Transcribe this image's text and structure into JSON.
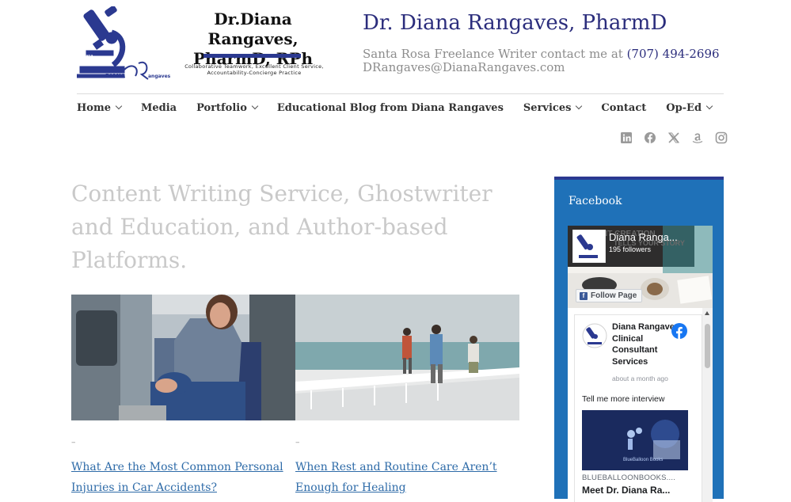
{
  "logo": {
    "title": "Dr.Diana Rangaves, PharmD, RPh",
    "tagline": "Collaborative Teamwork, Excellent Client Service, Accountability-Concierge Practice",
    "mark_text_left": "DIANA",
    "mark_text_right": "angaves",
    "mark_small": "Diana"
  },
  "header": {
    "site_title": "Dr. Diana Rangaves, PharmD",
    "tagline_text": "Santa Rosa Freelance Writer contact me at ",
    "phone": "(707) 494-2696",
    "email": "DRangaves@DianaRangaves.com"
  },
  "nav": {
    "items": [
      {
        "label": "Home"
      },
      {
        "label": "Media"
      },
      {
        "label": "Portfolio"
      },
      {
        "label": "Educational Blog from Diana Rangaves"
      },
      {
        "label": "Services"
      },
      {
        "label": "Contact"
      },
      {
        "label": "Op-Ed"
      }
    ]
  },
  "social": {
    "icons": [
      "linkedin-icon",
      "facebook-icon",
      "x-icon",
      "amazon-icon",
      "instagram-icon"
    ]
  },
  "main": {
    "title": "Content Writing Service, Ghostwriter and Education, and Author-based Platforms.",
    "posts": [
      {
        "dash": "–",
        "title": "What Are the Most Common Personal Injuries in Car Accidents?"
      },
      {
        "dash": "–",
        "title": "When Rest and Routine Care Aren’t Enough for Healing"
      }
    ]
  },
  "sidebar": {
    "heading": "Facebook",
    "fb": {
      "cover_text": "CONTENT CREATION",
      "cover_text2": "TELLS YOUR STORY",
      "page_name": "Diana Ranga...",
      "followers": "195 followers",
      "follow_label": "Follow Page",
      "post_author": "Diana Rangaves Clinical Consultant Services",
      "post_time": "about a month ago",
      "post_text": "Tell me more interview",
      "link_image_label": "BlueBalloon Books",
      "link_domain": "BLUEBALLOONBOOKS....",
      "link_title": "Meet Dr. Diana Ra..."
    }
  }
}
